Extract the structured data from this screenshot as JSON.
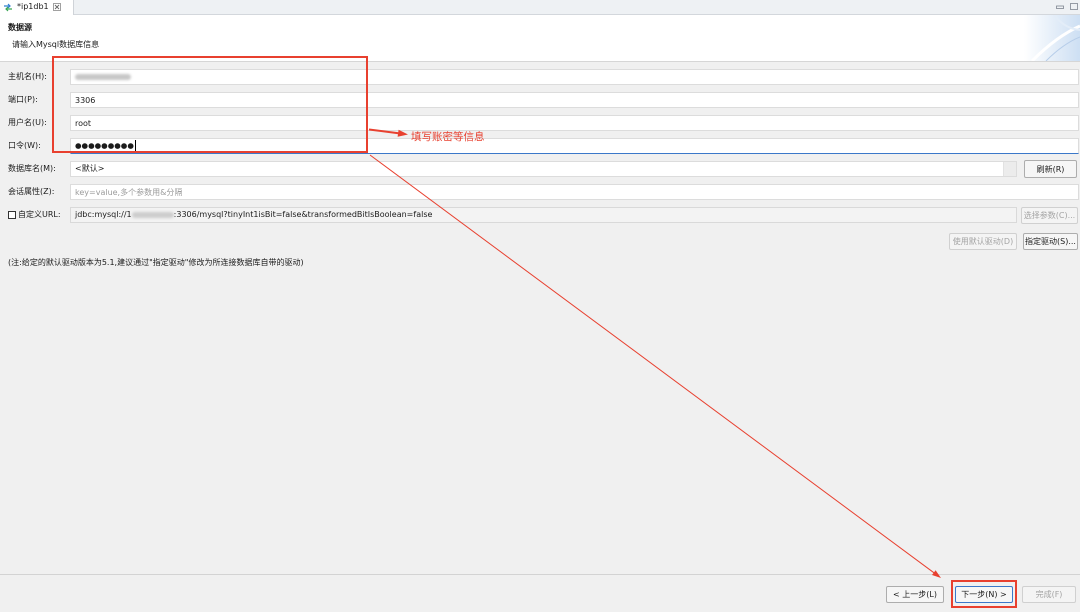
{
  "tab": {
    "title": "*ip1db1"
  },
  "header": {
    "title": "数据源",
    "description": "请输入Mysql数据库信息"
  },
  "fields": {
    "host": {
      "label": "主机名(H):"
    },
    "port": {
      "label": "端口(P):",
      "value": "3306"
    },
    "user": {
      "label": "用户名(U):",
      "value": "root"
    },
    "password": {
      "label": "口令(W):",
      "value": "●●●●●●●●●"
    },
    "database": {
      "label": "数据库名(M):",
      "value": "<默认>"
    },
    "session": {
      "label": "会话属性(Z):",
      "placeholder": "key=value,多个参数用&分隔"
    },
    "custom_url": {
      "label": "自定义URL:",
      "checked": false,
      "value_prefix": "jdbc:mysql://1",
      "value_suffix": ":3306/mysql?tinyInt1isBit=false&transformedBitIsBoolean=false"
    }
  },
  "buttons": {
    "refresh": {
      "label": "刷新(R)",
      "enabled": true
    },
    "select_params": {
      "label": "选择参数(C)...",
      "enabled": false
    },
    "default_driver": {
      "label": "使用默认驱动(D)",
      "enabled": false
    },
    "specify_driver": {
      "label": "指定驱动(S)...",
      "enabled": true
    },
    "back": {
      "label": "< 上一步(L)",
      "enabled": true
    },
    "next": {
      "label": "下一步(N) >",
      "enabled": true
    },
    "finish": {
      "label": "完成(F)",
      "enabled": false
    }
  },
  "note": "(注:给定的默认驱动版本为5.1,建议通过\"指定驱动\"修改为所连接数据库自带的驱动)",
  "annotations": {
    "callout_text": "填写账密等信息",
    "color": "#e8402f"
  },
  "theme": {
    "focus_color": "#3b78c9",
    "panel_bg": "#f0f0f0",
    "header_bg": "#ffffff",
    "disabled_text": "#a3a3a3"
  },
  "icons": {
    "tab": "connection-icon",
    "tab_close": "close-icon",
    "minimize": "minimize-icon",
    "maximize": "maximize-icon"
  }
}
